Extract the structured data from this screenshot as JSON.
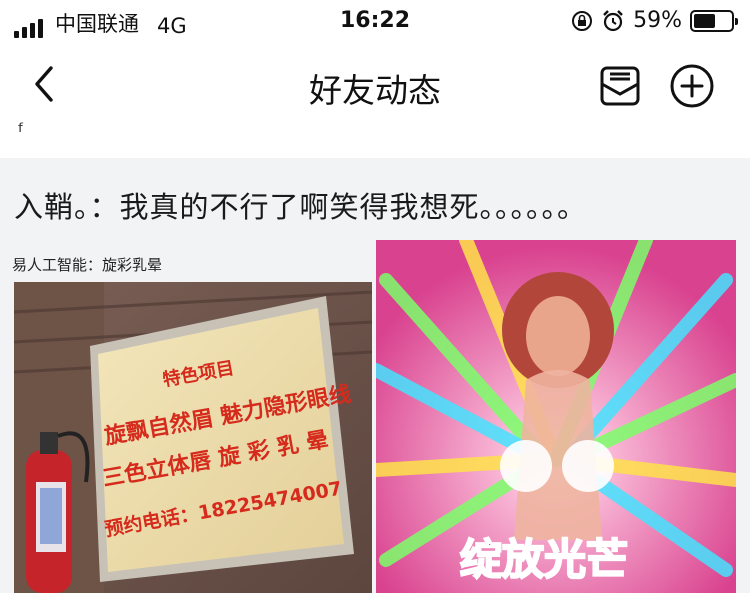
{
  "status_bar": {
    "carrier": "中国联通",
    "network": "4G",
    "time": "16:22",
    "battery_percent": "59%",
    "battery_level": 0.59
  },
  "nav": {
    "title": "好友动态"
  },
  "partial_glyph": "ᶠ",
  "post": {
    "text": "入鞘。：我真的不行了啊笑得我想死。。。。。。",
    "image_caption": "易人工智能：旋彩乳晕",
    "sign": {
      "line1": "特色项目",
      "line2": "旋飘自然眉 魅力隐形眼线",
      "line3": "三色立体唇 旋 彩 乳 晕",
      "line4": "预约电话：18225474007"
    },
    "meme_caption": "绽放光芒"
  },
  "colors": {
    "accent": "#111111",
    "sign_text": "#d52a1c",
    "sign_bg": "#efe0ad",
    "meme_bg": "#e86fae"
  }
}
